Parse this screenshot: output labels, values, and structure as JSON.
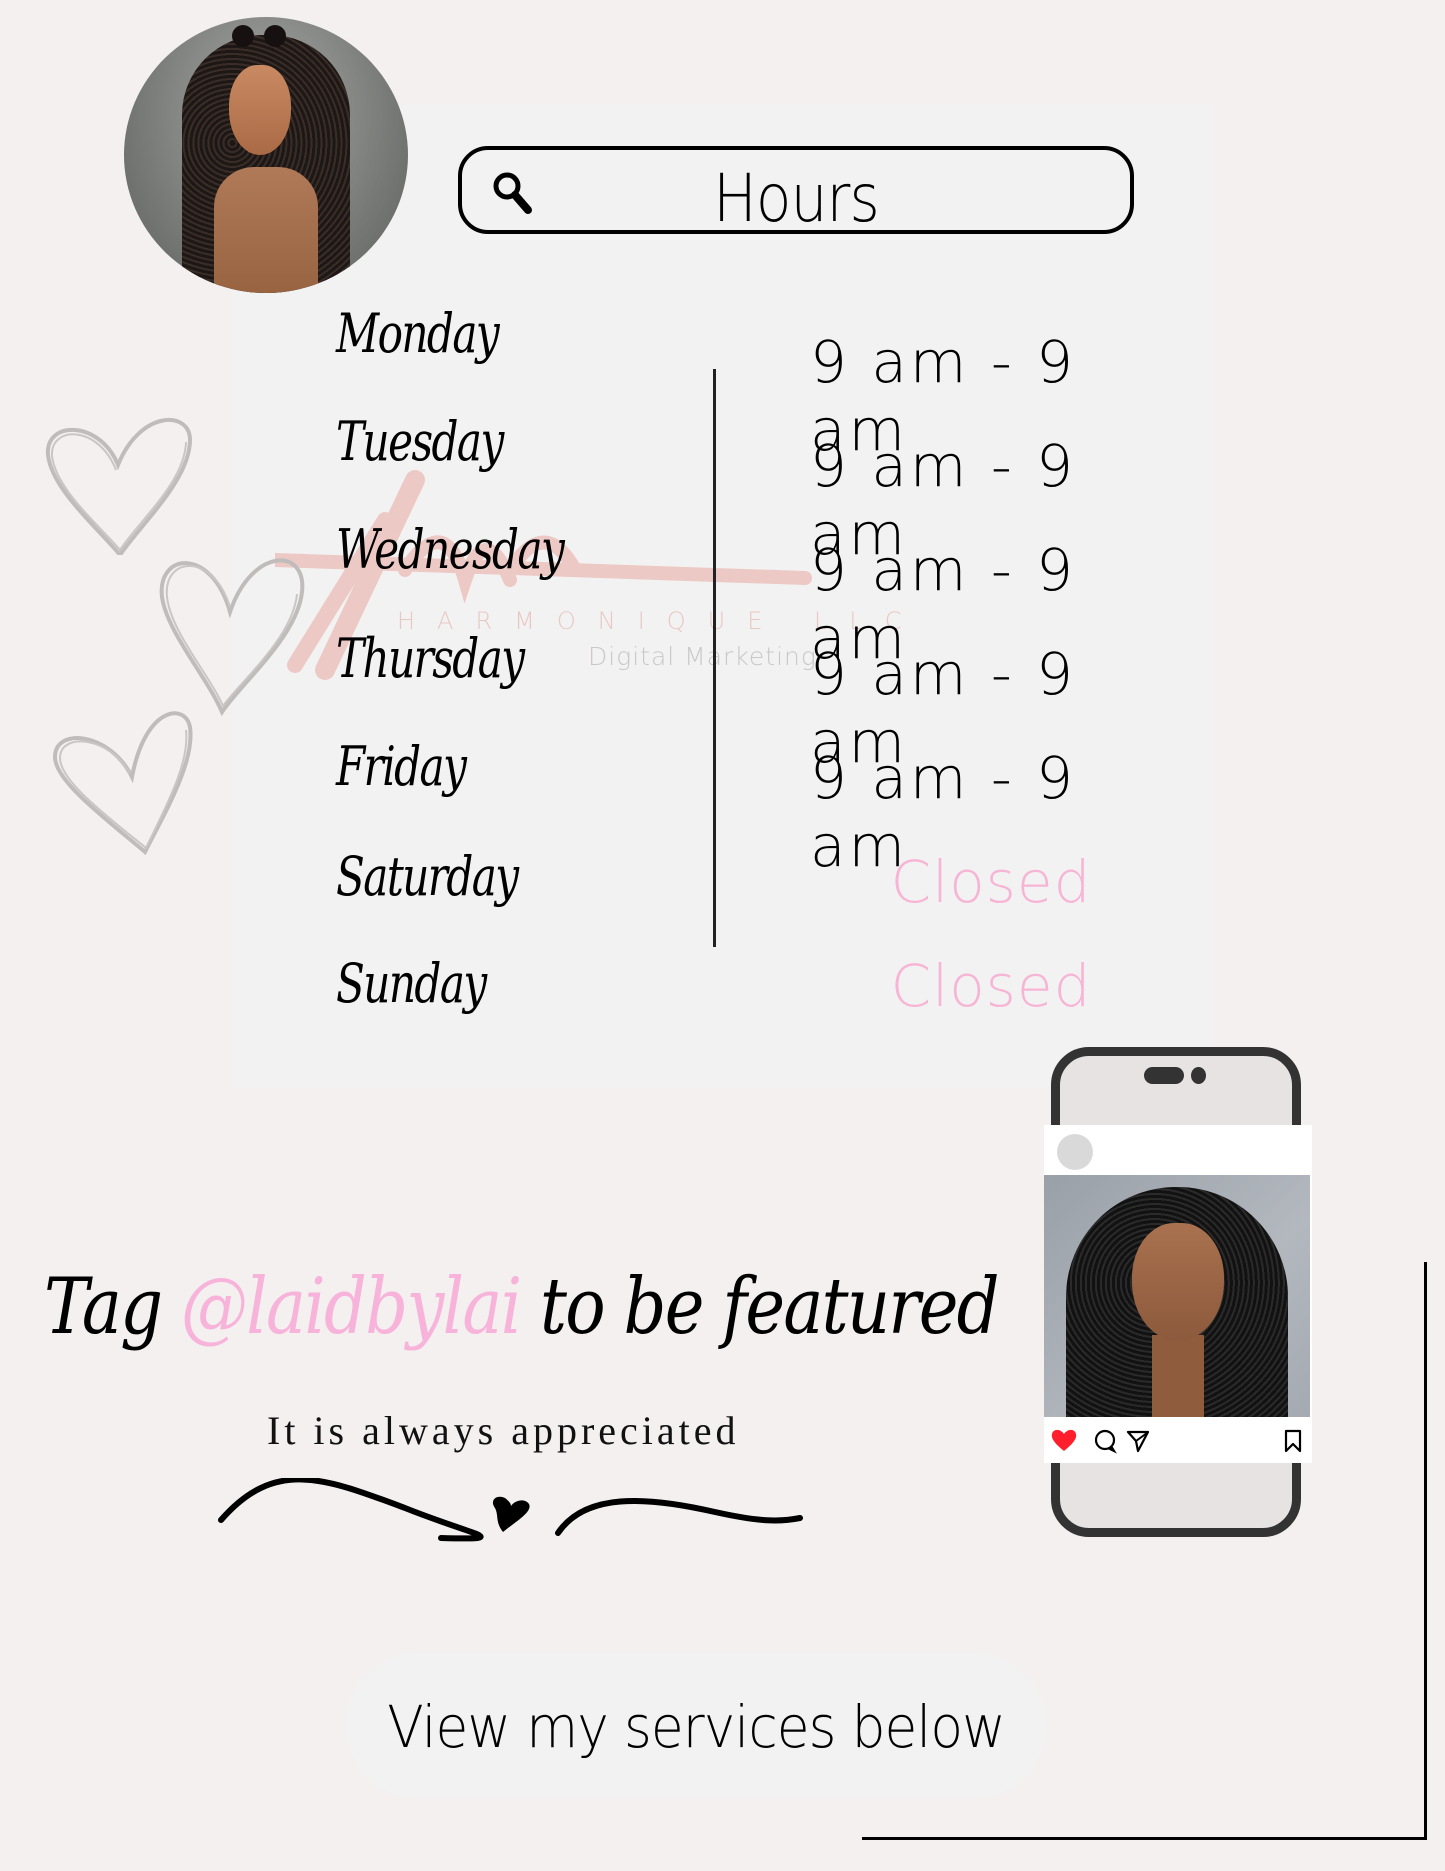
{
  "header": {
    "title": "Hours",
    "search_icon": "search-icon"
  },
  "schedule": [
    {
      "day": "Monday",
      "hours": "9 am - 9 am",
      "closed": false
    },
    {
      "day": "Tuesday",
      "hours": "9 am - 9 am",
      "closed": false
    },
    {
      "day": "Wednesday",
      "hours": "9 am - 9 am",
      "closed": false
    },
    {
      "day": "Thursday",
      "hours": "9 am - 9 am",
      "closed": false
    },
    {
      "day": "Friday",
      "hours": "9 am - 9 am",
      "closed": false
    },
    {
      "day": "Saturday",
      "hours": "Closed",
      "closed": true
    },
    {
      "day": "Sunday",
      "hours": "Closed",
      "closed": true
    }
  ],
  "watermark": {
    "company": "HARMONIQUE LLC",
    "tagline": "Digital Marketing"
  },
  "promo": {
    "tag_prefix": "Tag ",
    "handle": "@laidbylai",
    "tag_suffix": " to be featured",
    "subtitle": "It is always appreciated"
  },
  "phone_post": {
    "icons": [
      "heart-icon",
      "comment-icon",
      "share-icon",
      "bookmark-icon"
    ]
  },
  "cta": {
    "label": "View my services below"
  },
  "colors": {
    "background": "#f3f0ef",
    "closed_pink": "#f7b5d6",
    "handle_pink": "#f7b3d9",
    "like_red": "#ff1e2b",
    "watermark_rose": "#e8a9a0"
  }
}
